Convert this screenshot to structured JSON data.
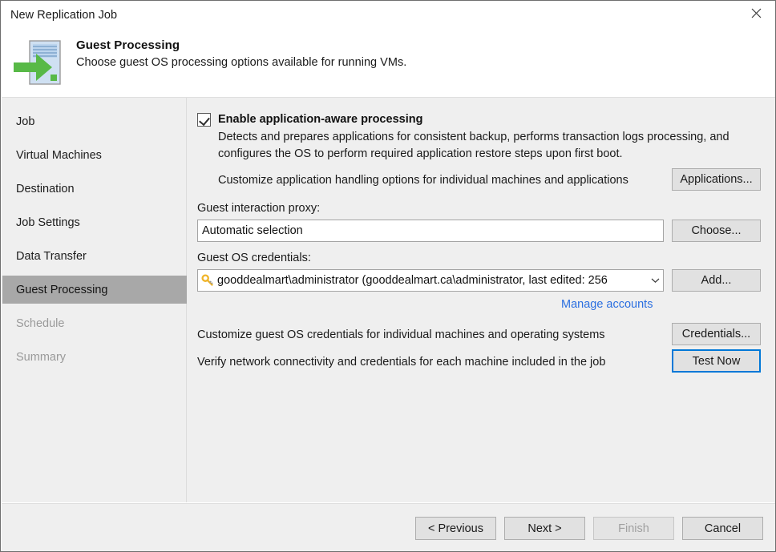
{
  "window": {
    "title": "New Replication Job",
    "close_label": "✕"
  },
  "header": {
    "title": "Guest Processing",
    "subtitle": "Choose guest OS processing options available for running VMs.",
    "icon": "replication-job-icon"
  },
  "sidebar": {
    "items": [
      {
        "label": "Job",
        "state": "normal"
      },
      {
        "label": "Virtual Machines",
        "state": "normal"
      },
      {
        "label": "Destination",
        "state": "normal"
      },
      {
        "label": "Job Settings",
        "state": "normal"
      },
      {
        "label": "Data Transfer",
        "state": "normal"
      },
      {
        "label": "Guest Processing",
        "state": "selected"
      },
      {
        "label": "Schedule",
        "state": "disabled"
      },
      {
        "label": "Summary",
        "state": "disabled"
      }
    ]
  },
  "content": {
    "app_aware": {
      "checkbox_label": "Enable application-aware processing",
      "checked": true,
      "description_line1": "Detects and prepares applications for consistent backup, performs transaction logs processing, and",
      "description_line2": "configures the OS to perform required application restore steps upon first boot.",
      "customize_text": "Customize application handling options for individual machines and applications",
      "applications_button": "Applications..."
    },
    "proxy": {
      "label": "Guest interaction proxy:",
      "value": "Automatic selection",
      "choose_button": "Choose..."
    },
    "credentials": {
      "label": "Guest OS credentials:",
      "value": "gooddealmart\\administrator (gooddealmart.ca\\administrator, last edited: 256",
      "icon": "key-icon",
      "dropdown_arrow": "chevron-down-icon",
      "add_button": "Add...",
      "manage_link": "Manage accounts"
    },
    "customize_credentials": {
      "text": "Customize guest OS credentials for individual machines and operating systems",
      "button": "Credentials..."
    },
    "test": {
      "text": "Verify network connectivity and credentials for each machine included in the job",
      "button": "Test Now"
    }
  },
  "footer": {
    "previous_button": "< Previous",
    "next_button": "Next >",
    "finish_button": "Finish",
    "cancel_button": "Cancel",
    "finish_disabled": true
  },
  "colors": {
    "accent": "#0078d7",
    "link": "#2b6fe0",
    "selected_item": "#a8a8a8",
    "panel": "#efefef",
    "key_icon": "#f0b428",
    "arrow_green": "#58b947"
  }
}
